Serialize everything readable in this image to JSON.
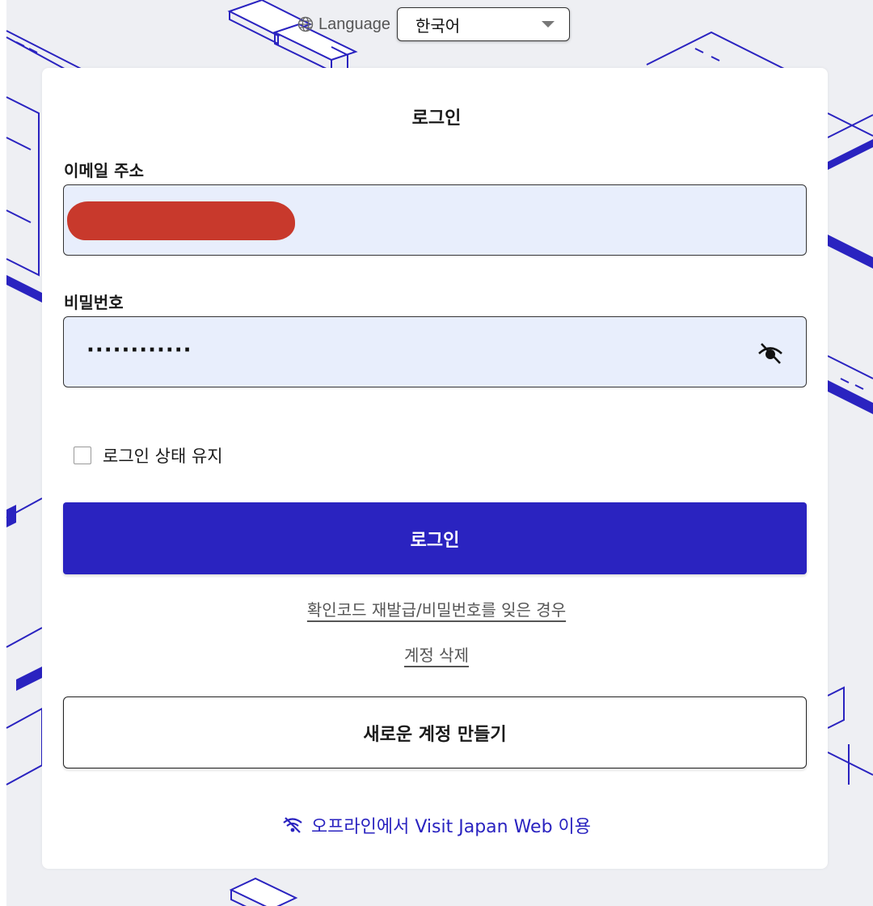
{
  "language": {
    "label": "Language",
    "selected": "한국어"
  },
  "form": {
    "title": "로그인",
    "email_label": "이메일 주소",
    "password_label": "비밀번호",
    "password_value": "············",
    "remember_label": "로그인 상태 유지",
    "login_button": "로그인",
    "reset_link": "확인코드 재발급/비밀번호를 잊은 경우",
    "delete_link": "계정 삭제",
    "create_button": "새로운 계정 만들기",
    "offline_link": "오프라인에서 Visit Japan Web 이용"
  },
  "colors": {
    "accent": "#2a23c0",
    "input_bg": "#e8eefc",
    "redaction": "#c8392c"
  },
  "icons": [
    "globe-icon",
    "caret-down-icon",
    "eye-off-icon",
    "wifi-off-icon"
  ]
}
